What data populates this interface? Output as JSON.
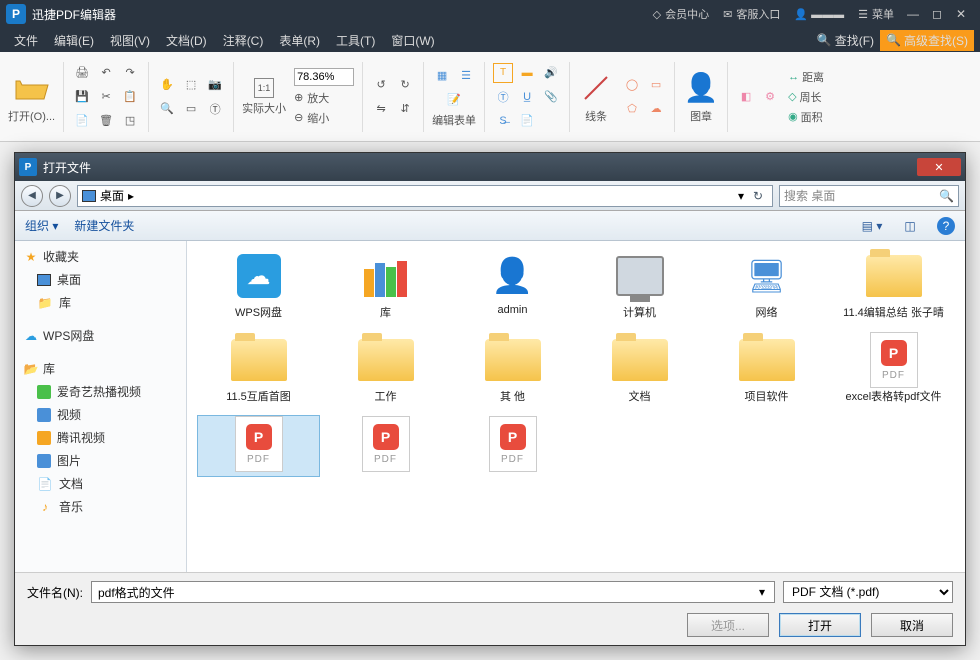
{
  "app": {
    "icon_letter": "P",
    "title": "迅捷PDF编辑器",
    "header_links": {
      "member": "会员中心",
      "support": "客服入口",
      "menu": "菜单"
    }
  },
  "menubar": {
    "items": [
      "文件",
      "编辑(E)",
      "视图(V)",
      "文档(D)",
      "注释(C)",
      "表单(R)",
      "工具(T)",
      "窗口(W)"
    ],
    "find": "查找(F)",
    "adv_find": "高级查找(S)"
  },
  "ribbon": {
    "open": "打开(O)...",
    "zoom_value": "78.36%",
    "real_size": "实际大小",
    "zoom_in": "放大",
    "zoom_out": "缩小",
    "edit_form": "编辑表单",
    "lines": "线条",
    "image": "图章",
    "distance": "距离",
    "perimeter": "周长",
    "area": "面积"
  },
  "dialog": {
    "title": "打开文件",
    "location": "桌面",
    "search_placeholder": "搜索 桌面",
    "toolbar": {
      "organize": "组织",
      "new_folder": "新建文件夹"
    },
    "nav": {
      "favorites": {
        "label": "收藏夹",
        "items": [
          "桌面",
          "库"
        ]
      },
      "wps": "WPS网盘",
      "library": {
        "label": "库",
        "items": [
          "爱奇艺热播视频",
          "视频",
          "腾讯视频",
          "图片",
          "文档",
          "音乐"
        ]
      }
    },
    "files_row1": [
      {
        "name": "WPS网盘",
        "type": "wps"
      },
      {
        "name": "库",
        "type": "lib"
      },
      {
        "name": "admin",
        "type": "user"
      },
      {
        "name": "计算机",
        "type": "pc"
      },
      {
        "name": "网络",
        "type": "net"
      },
      {
        "name": "11.4编辑总结 张子晴",
        "type": "folder"
      }
    ],
    "files_row2": [
      {
        "name": "11.5互盾首图",
        "type": "folder"
      },
      {
        "name": "工作",
        "type": "folder"
      },
      {
        "name": "其 他",
        "type": "folder"
      },
      {
        "name": "文档",
        "type": "folder"
      },
      {
        "name": "项目软件",
        "type": "folder"
      },
      {
        "name": "excel表格转pdf文件",
        "type": "pdf"
      }
    ],
    "files_row3": [
      {
        "name": "",
        "type": "pdf",
        "selected": true
      },
      {
        "name": "",
        "type": "pdf"
      },
      {
        "name": "",
        "type": "pdf"
      }
    ],
    "filename_label": "文件名(N):",
    "filename_value": "pdf格式的文件",
    "filetype": "PDF 文档 (*.pdf)",
    "btn_options": "选项...",
    "btn_open": "打开",
    "btn_cancel": "取消"
  }
}
